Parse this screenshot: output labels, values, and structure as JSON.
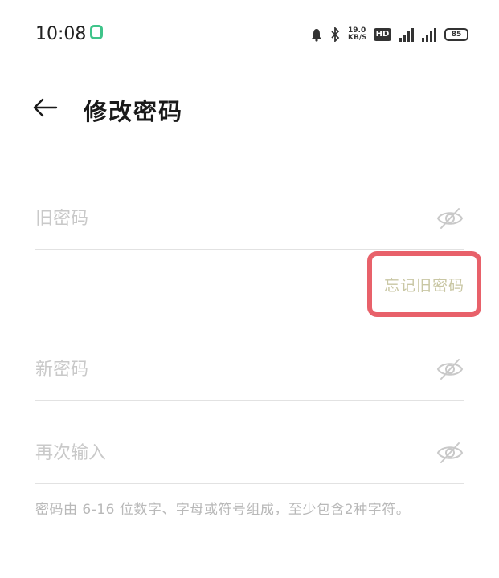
{
  "status_bar": {
    "time": "10:08",
    "speed_top": "19.0",
    "speed_bottom": "KB/S",
    "hd_label": "HD",
    "battery": "85"
  },
  "header": {
    "title": "修改密码"
  },
  "form": {
    "old_password_placeholder": "旧密码",
    "forgot_link": "忘记旧密码",
    "new_password_placeholder": "新密码",
    "confirm_placeholder": "再次输入",
    "hint": "密码由 6-16 位数字、字母或符号组成，至少包含2种字符。"
  },
  "colors": {
    "accent_highlight": "#e8616a",
    "app_indicator": "#3fc48a",
    "placeholder": "#c9c9c9"
  },
  "icons": {
    "back": "arrow-left-icon",
    "visibility": "eye-off-icon"
  }
}
